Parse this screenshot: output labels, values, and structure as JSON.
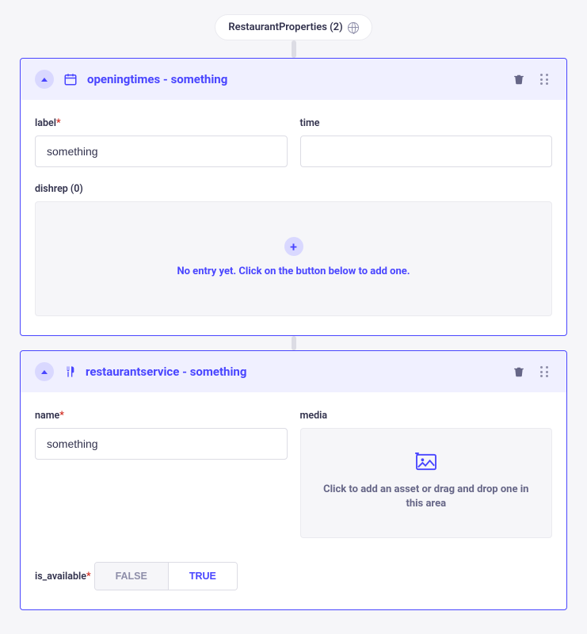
{
  "root": {
    "label": "RestaurantProperties (2)"
  },
  "cards": [
    {
      "title": "openingtimes - something",
      "fields": {
        "label": {
          "label": "label",
          "required": true,
          "value": "something"
        },
        "time": {
          "label": "time",
          "required": false,
          "value": ""
        }
      },
      "dishrep": {
        "label": "dishrep (0)",
        "empty_text": "No entry yet. Click on the button below to add one."
      }
    },
    {
      "title": "restaurantservice - something",
      "fields": {
        "name": {
          "label": "name",
          "required": true,
          "value": "something"
        },
        "media": {
          "label": "media",
          "drop_text": "Click to add an asset or drag and drop one in this area"
        }
      },
      "is_available": {
        "label": "is_available",
        "required": true,
        "options": {
          "false": "FALSE",
          "true": "TRUE"
        },
        "value": "TRUE"
      }
    }
  ]
}
